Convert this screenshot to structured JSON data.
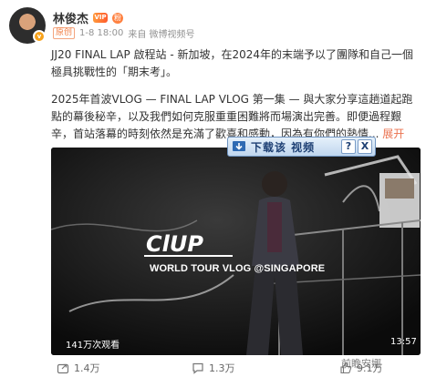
{
  "author": {
    "name": "林俊杰",
    "avatar_badge": "v",
    "vip_badge": "VIP",
    "fans_badge": "粉"
  },
  "meta": {
    "origin_tag": "原创",
    "date": "1-8 18:00",
    "source": "来自 微博视频号"
  },
  "post": {
    "line1": "JJ20 FINAL LAP 啟程站 - 新加坡，在2024年的末端予以了團隊和自己一個極具挑戰性的「期末考」。",
    "line2": "2025年首波VLOG — FINAL LAP VLOG 第一集 — 與大家分享這趟道起跑點的幕後秘辛，以及我們如何克服重重困難將而場演出完善。即便過程艱辛，首站落幕的時刻依然是充滿了歡喜和感動，因為有你們的熱情...",
    "expand": "展开"
  },
  "video": {
    "logo_text": "ClUP",
    "tour_title": "WORLD TOUR VLOG @SINGAPORE",
    "views": "141万次观看",
    "duration": "13:57"
  },
  "download_overlay": {
    "label": "下载该 视频",
    "help": "?",
    "close": "X"
  },
  "footer": {
    "shares": "1.4万",
    "comments": "1.3万",
    "likes": "9.1万"
  },
  "watermark": "前瞻安娜",
  "icons": [
    "share-icon",
    "comment-icon",
    "like-icon",
    "download-icon",
    "help-icon",
    "close-icon"
  ]
}
